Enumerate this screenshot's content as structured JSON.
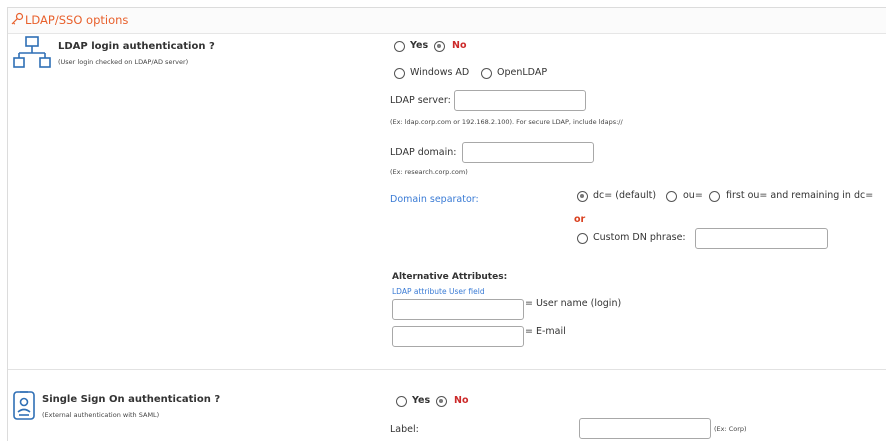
{
  "header": {
    "title": "LDAP/SSO options",
    "icon": "key-icon",
    "accent": "#e8602c"
  },
  "ldap": {
    "icon": "network-icon",
    "title": "LDAP login authentication ?",
    "subtitle": "(User login checked on LDAP/AD server)",
    "enabled_yes": "Yes",
    "enabled_no": "No",
    "enabled_value": "No",
    "type_windows": "Windows AD",
    "type_openldap": "OpenLDAP",
    "server_label": "LDAP server:",
    "server_value": "",
    "server_hint": "(Ex: ldap.corp.com or 192.168.2.100). For secure LDAP, include ldaps://",
    "domain_label": "LDAP domain:",
    "domain_value": "",
    "domain_hint": "(Ex: research.corp.com)",
    "separator_label": "Domain separator:",
    "separator_opts": [
      "dc= (default)",
      "ou=",
      "first ou= and remaining in dc="
    ],
    "separator_value": "dc= (default)",
    "or_text": "or",
    "custom_dn_label": "Custom DN phrase:",
    "custom_dn_value": "",
    "alt_attr_title": "Alternative Attributes:",
    "alt_attr_sub": "LDAP attribute User field",
    "attr_username_value": "",
    "attr_username_label": "= User name (login)",
    "attr_email_value": "",
    "attr_email_label": "= E-mail"
  },
  "sso": {
    "icon": "id-badge-icon",
    "title": "Single Sign On authentication ?",
    "subtitle": "(External authentication with SAML)",
    "enabled_yes": "Yes",
    "enabled_no": "No",
    "enabled_value": "No",
    "label_label": "Label:",
    "label_value": "",
    "label_hint": "(Ex: Corp)"
  }
}
